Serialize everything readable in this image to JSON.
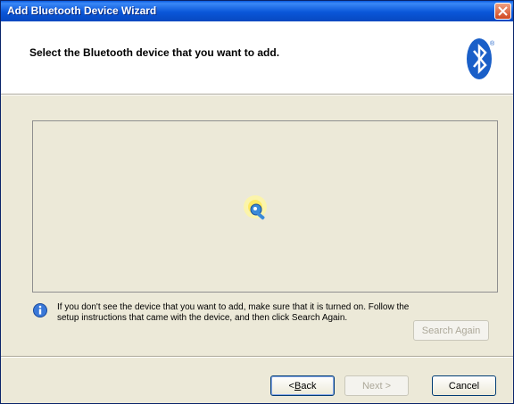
{
  "window": {
    "title": "Add Bluetooth Device Wizard"
  },
  "header": {
    "heading": "Select the Bluetooth device that you want to add."
  },
  "info": {
    "text": "If you don't see the device that you want to add, make sure that it is turned on. Follow the setup instructions that came with the device, and then click Search Again."
  },
  "buttons": {
    "search_again": "Search Again",
    "back_prefix": "< ",
    "back_mnemonic": "B",
    "back_rest": "ack",
    "next": "Next >",
    "cancel": "Cancel"
  },
  "icons": {
    "close": "close-icon",
    "bluetooth": "bluetooth-logo-icon",
    "search": "searching-device-icon",
    "info": "info-icon"
  },
  "colors": {
    "titlebar": "#0a56d8",
    "bluetooth_blue": "#1a5fc8",
    "dialog_bg": "#ece9d8"
  }
}
